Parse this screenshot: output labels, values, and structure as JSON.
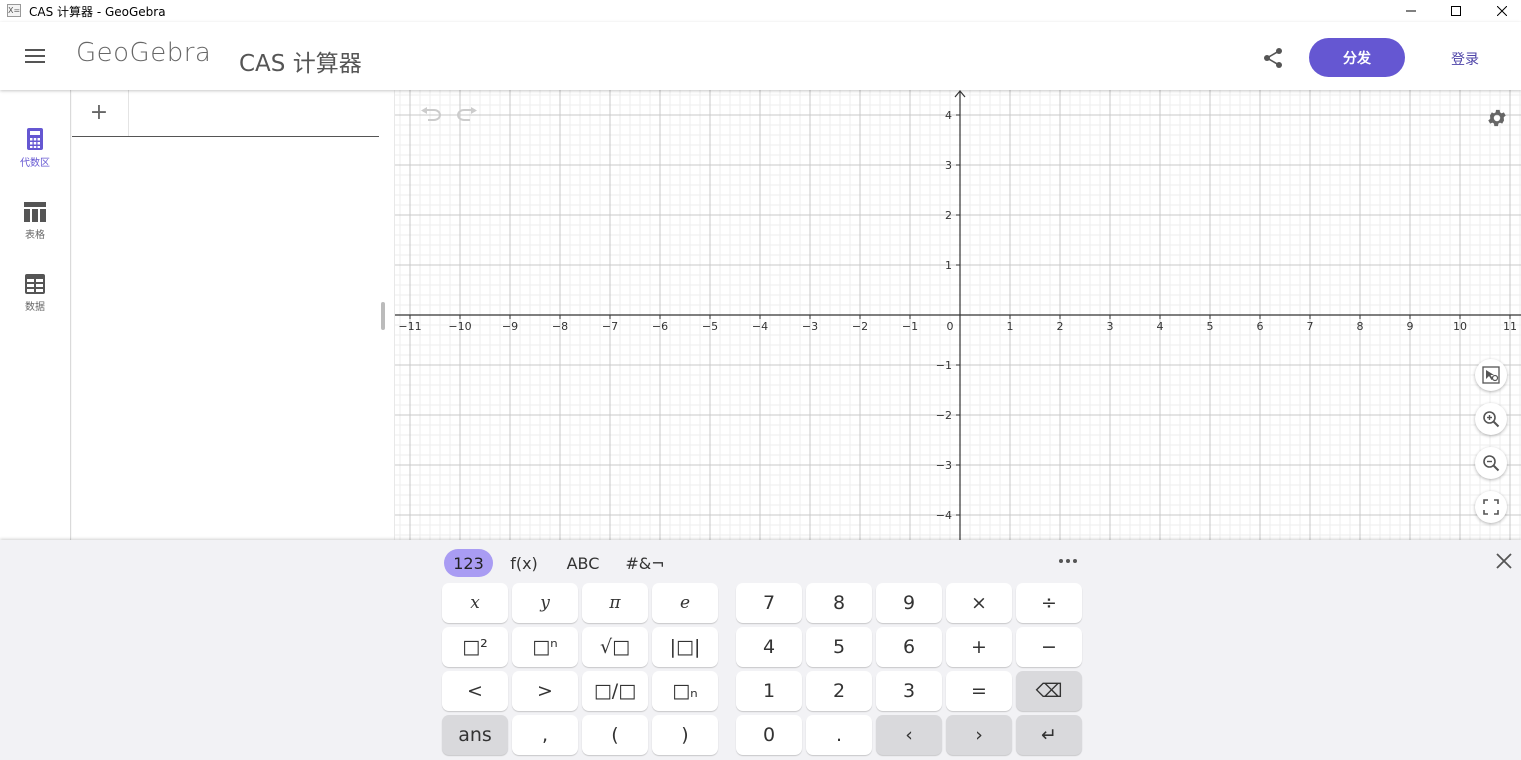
{
  "window": {
    "title": "CAS 计算器 - GeoGebra",
    "app_icon_text": "X="
  },
  "header": {
    "logo": "GeoGebra",
    "app_name": "CAS 计算器",
    "share_label": "分发",
    "login_label": "登录"
  },
  "sidebar": {
    "items": [
      {
        "label": "代数区",
        "icon": "calculator-icon",
        "active": true
      },
      {
        "label": "表格",
        "icon": "table-icon",
        "active": false
      },
      {
        "label": "数据",
        "icon": "data-icon",
        "active": false
      }
    ]
  },
  "algebra": {
    "add_label": "+",
    "input_value": ""
  },
  "graphics": {
    "x_ticks": [
      "−11",
      "−10",
      "−9",
      "−8",
      "−7",
      "−6",
      "−5",
      "−4",
      "−3",
      "−2",
      "−1",
      "0",
      "1",
      "2",
      "3",
      "4",
      "5",
      "6",
      "7",
      "8",
      "9",
      "10",
      "11"
    ],
    "y_ticks": [
      "4",
      "3",
      "2",
      "1",
      "−1",
      "−2",
      "−3",
      "−4"
    ],
    "x_range": [
      -11,
      11
    ],
    "y_range": [
      -4.5,
      4.5
    ],
    "accent_color": "#6557d2"
  },
  "keyboard": {
    "tabs": [
      {
        "label": "123",
        "active": true
      },
      {
        "label": "f(x)",
        "active": false
      },
      {
        "label": "ABC",
        "active": false
      },
      {
        "label": "#&¬",
        "active": false
      }
    ],
    "left_keys": [
      [
        "x",
        "y",
        "π",
        "e"
      ],
      [
        "□²",
        "□ⁿ",
        "√□",
        "|□|"
      ],
      [
        "<",
        ">",
        "□/□",
        "□ₙ"
      ],
      [
        "ans",
        ",",
        "(",
        ")"
      ]
    ],
    "right_keys": [
      [
        "7",
        "8",
        "9",
        "×",
        "÷"
      ],
      [
        "4",
        "5",
        "6",
        "+",
        "−"
      ],
      [
        "1",
        "2",
        "3",
        "=",
        "⌫"
      ],
      [
        "0",
        ".",
        "‹",
        "›",
        "↵"
      ]
    ]
  }
}
